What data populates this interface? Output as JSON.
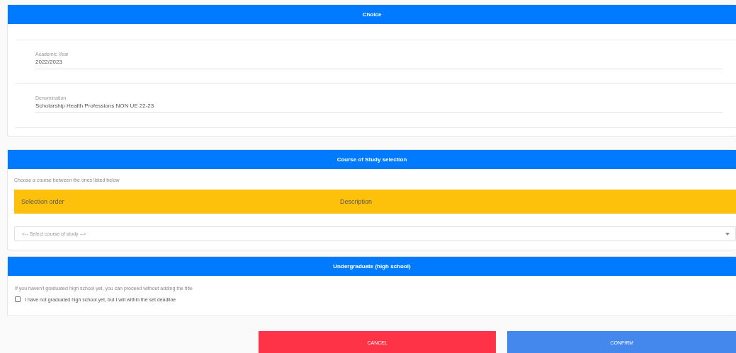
{
  "choice": {
    "title": "Choice",
    "fields": [
      {
        "label": "Academic Year",
        "value": "2022/2023"
      },
      {
        "label": "Denomination",
        "value": "Scholarship Health Professions NON UE 22-23"
      }
    ]
  },
  "course_selection": {
    "title": "Course of Study selection",
    "instruction": "Choose a course between the ones listed below",
    "columns": [
      "Selection order",
      "Description"
    ],
    "select": {
      "placeholder": "<-- Select course of study -->"
    }
  },
  "undergraduate": {
    "title": "Undergraduate (high school)",
    "note": "If you haven't graduated high school yet, you can proceed without adding the title",
    "checkbox": {
      "label": "I have not graduated high school yet, but I will within the set deadline",
      "checked": false
    }
  },
  "buttons": [
    {
      "label": "CANCEL",
      "kind": "danger"
    },
    {
      "label": "CONFIRM",
      "kind": "primary"
    }
  ]
}
